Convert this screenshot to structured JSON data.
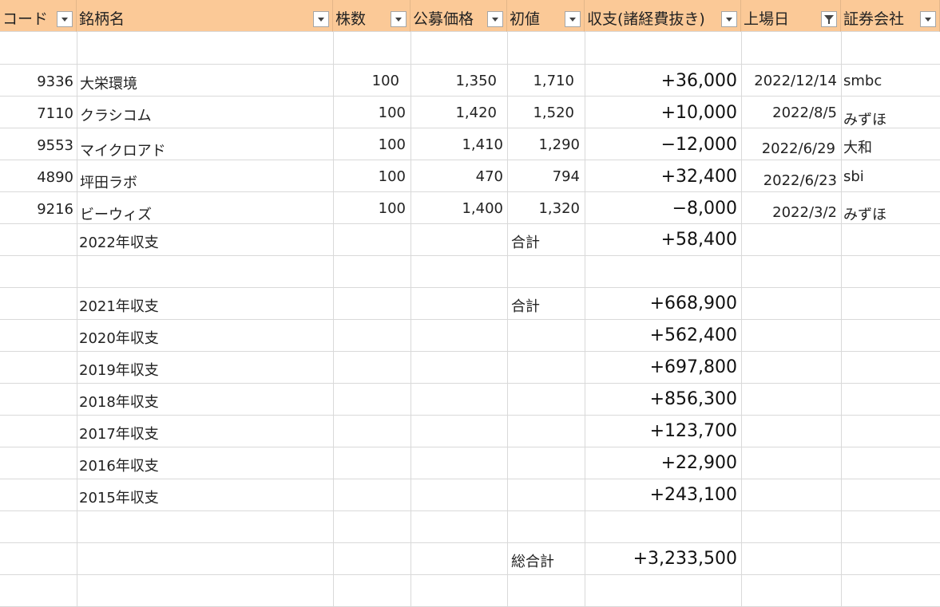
{
  "headers": [
    "コード",
    "銘柄名",
    "株数",
    "公募価格",
    "初値",
    "収支(諸経費抜き)",
    "上場日",
    "証券会社"
  ],
  "rows": [
    {
      "code": "9336",
      "name": "大栄環境",
      "shares": "100",
      "offer": "1,350",
      "initial": "1,710",
      "profit": "+36,000",
      "date": "2022/12/14",
      "broker": "smbc"
    },
    {
      "code": "7110",
      "name": "クラシコム",
      "shares": "100",
      "offer": "1,420",
      "initial": "1,520",
      "profit": "+10,000",
      "date": "2022/8/5",
      "broker": "みずほ"
    },
    {
      "code": "9553",
      "name": "マイクロアド",
      "shares": "100",
      "offer": "1,410",
      "initial": "1,290",
      "profit": "−12,000",
      "date": "2022/6/29",
      "broker": "大和"
    },
    {
      "code": "4890",
      "name": "坪田ラボ",
      "shares": "100",
      "offer": "470",
      "initial": "794",
      "profit": "+32,400",
      "date": "2022/6/23",
      "broker": "sbi"
    },
    {
      "code": "9216",
      "name": "ビーウィズ",
      "shares": "100",
      "offer": "1,400",
      "initial": "1,320",
      "profit": "−8,000",
      "date": "2022/3/2",
      "broker": "みずほ"
    }
  ],
  "summary_2022": {
    "label": "2022年収支",
    "total_label": "合計",
    "value": "+58,400"
  },
  "yearly": [
    {
      "label": "2021年収支",
      "total_label": "合計",
      "value": "+668,900"
    },
    {
      "label": "2020年収支",
      "total_label": "",
      "value": "+562,400"
    },
    {
      "label": "2019年収支",
      "total_label": "",
      "value": "+697,800"
    },
    {
      "label": "2018年収支",
      "total_label": "",
      "value": "+856,300"
    },
    {
      "label": "2017年収支",
      "total_label": "",
      "value": "+123,700"
    },
    {
      "label": "2016年収支",
      "total_label": "",
      "value": "+22,900"
    },
    {
      "label": "2015年収支",
      "total_label": "",
      "value": "+243,100"
    }
  ],
  "grand_total": {
    "label": "総合計",
    "value": "+3,233,500"
  },
  "colors": {
    "header_bg": "#fbc997",
    "grid": "#d9d9d9"
  }
}
